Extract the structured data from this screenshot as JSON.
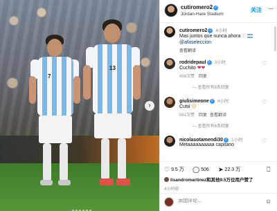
{
  "post": {
    "username": "cutiromero2",
    "location": "Jordan-Hare Stadium",
    "follow_label": "关注",
    "more_label": "···"
  },
  "caption": {
    "username": "cutiromero2",
    "time": "4小时",
    "text": "Mas juntos que nunca ahora",
    "mention": "@afaseleccion",
    "translate_label": "查看翻译"
  },
  "comments": [
    {
      "username": "rodridepaul",
      "time": "3小时",
      "text": "Cuchito",
      "likes": "458次赞",
      "reply": "回复",
      "translate": "",
      "replies": "查看所有8条回复"
    },
    {
      "username": "giulisimeone",
      "time": "4小时",
      "text": "Cutiii",
      "likes": "561次赞",
      "reply": "回复",
      "translate": "查看翻译",
      "replies": "查看所有6条回复"
    },
    {
      "username": "nicolasotamendi30",
      "time": "1小时",
      "text": "Metaaaaaaaaaa  capitano",
      "likes": "",
      "reply": "",
      "translate": "",
      "replies": ""
    }
  ],
  "actions": {
    "likes_count": "9.5 万",
    "comments_count": "506",
    "shares_count": "22.3 万"
  },
  "liked_by": "lisandromartinez和其他9.5万位用户赞了",
  "post_time": "4小时前",
  "add_comment": {
    "placeholder": "添加评论..."
  },
  "photo": {
    "player1_number": "7",
    "player2_number": "13"
  },
  "icons": {
    "heart": "heart-icon",
    "comment": "comment-icon",
    "share": "share-icon",
    "bookmark": "bookmark-icon",
    "emoji": "emoji-icon",
    "next": "chevron-right-icon"
  }
}
